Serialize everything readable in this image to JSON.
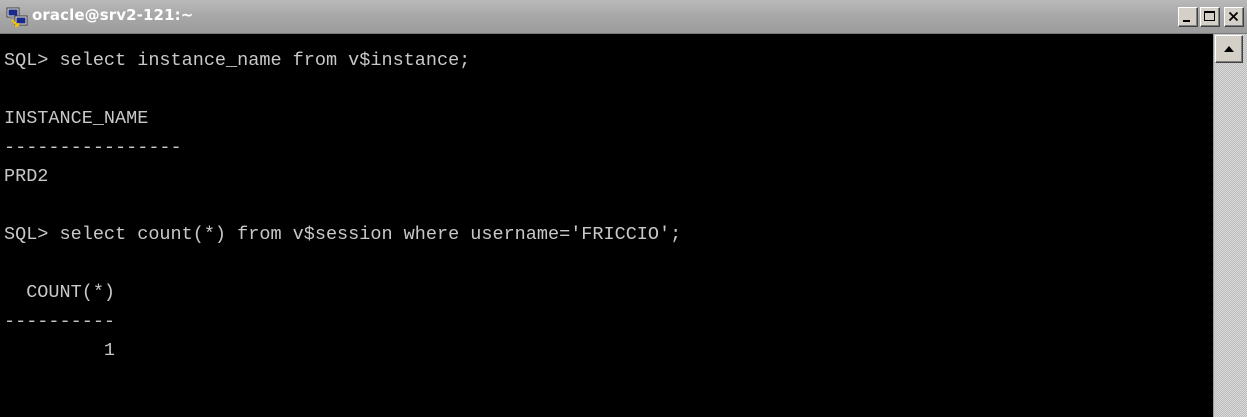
{
  "window": {
    "title": "oracle@srv2-121:~",
    "app_icon": "putty-icon",
    "controls": {
      "minimize": "minimize-icon",
      "maximize": "maximize-icon",
      "close": "close-icon"
    }
  },
  "terminal": {
    "background": "#000000",
    "foreground": "#c8c8c8",
    "lines": [
      "SQL> select instance_name from v$instance;",
      "",
      "INSTANCE_NAME",
      "----------------",
      "PRD2",
      "",
      "SQL> select count(*) from v$session where username='FRICCIO';",
      "",
      "  COUNT(*)",
      "----------",
      "         1"
    ]
  },
  "scrollbar": {
    "up_arrow": "scroll-up-arrow-icon"
  }
}
